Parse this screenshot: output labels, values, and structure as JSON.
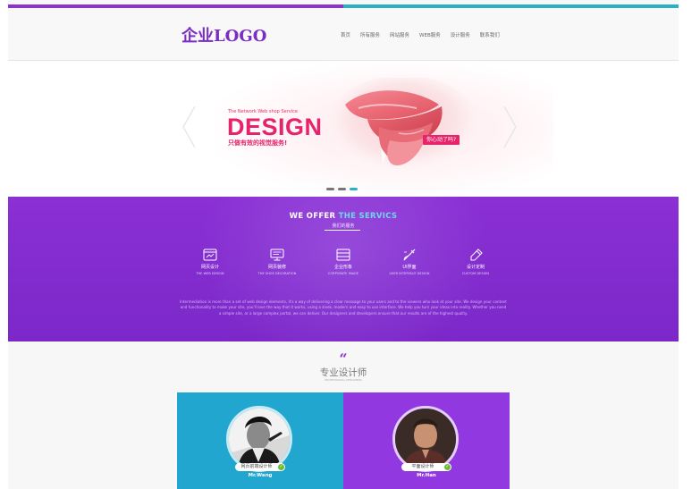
{
  "header": {
    "logo": "企业LOGO",
    "nav": [
      "首页",
      "所有服务",
      "网站服务",
      "WEB服务",
      "设计服务",
      "联系我们"
    ]
  },
  "banner": {
    "subtitle": "The Network Web shop Service",
    "title": "DESIGN",
    "slogan": "只做有效的视觉服务!",
    "tag": "你心动了吗?",
    "slides": 3,
    "active_slide": 3
  },
  "services": {
    "title_prefix": "WE OFFER",
    "title_highlight": "THE SERVICS",
    "subtitle_cn": "我们的服务",
    "items": [
      {
        "label": "网页设计",
        "en": "THE WEB DESIGN",
        "icon": "web-design-icon"
      },
      {
        "label": "网页装修",
        "en": "THE SHOE DECORATION",
        "icon": "monitor-icon"
      },
      {
        "label": "企业形象",
        "en": "CORPORATE IMAGE",
        "icon": "corporate-image-icon"
      },
      {
        "label": "UI界面",
        "en": "USER INTERFACE DESIGN",
        "icon": "brush-icon"
      },
      {
        "label": "设计定制",
        "en": "CUSTOM DESIGN",
        "icon": "pen-icon"
      }
    ],
    "description": "Intermediation is more than a set of web design elements, it's a way of delivering a clear message to your users and to the viewers who look at your site. We design your content and functionality to make your site, you'll love the way that it works, using a sleek, modern and easy to use interface. We help you turn your ideas into reality. Whether you need a simple site, or a large complex portal, we can deliver. Our designers and developers ensure that our results are of the highest quality."
  },
  "designers": {
    "title": "专业设计师",
    "subtitle_en": "PROFESSIONAL DESIGNERS",
    "cards": [
      {
        "role": "网页前端设计师",
        "name": "Mr.Wang",
        "bg": "#21a7cf"
      },
      {
        "role": "平面设计师",
        "name": "Mr.Han",
        "bg": "#9238e0"
      }
    ]
  },
  "colors": {
    "primary_purple": "#8d32cf",
    "accent_teal": "#2ab1c6",
    "banner_pink": "#e6246c"
  }
}
